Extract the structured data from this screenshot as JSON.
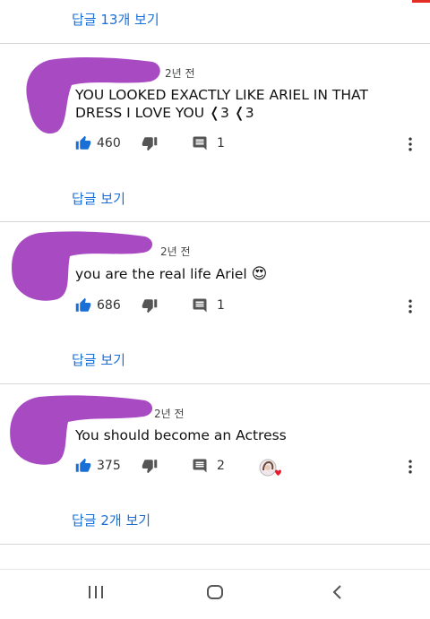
{
  "colors": {
    "link": "#1a6fd6",
    "scribble": "#a84bc3",
    "heart": "#e51c2c"
  },
  "top_replies_link": "답글 13개 보기",
  "comments": [
    {
      "time": "2년 전",
      "text": "YOU LOOKED EXACTLY LIKE ARIEL IN THAT DRESS I LOVE YOU ❬3 ❬3",
      "likes": "460",
      "replies_count": "1",
      "reply_link": "답글 보기"
    },
    {
      "time": "2년 전",
      "text": "you are the real life Ariel",
      "emoji": "😍",
      "likes": "686",
      "replies_count": "1",
      "reply_link": "답글 보기"
    },
    {
      "time": "2년 전",
      "text": "You should become an Actress",
      "likes": "375",
      "replies_count": "2",
      "reply_link": "답글 2개 보기",
      "creator_heart": true
    }
  ],
  "icons": [
    "thumb-up-icon",
    "thumb-down-icon",
    "comment-icon",
    "more-vert-icon",
    "creator-heart-icon",
    "recent-apps-icon",
    "home-icon",
    "back-icon"
  ]
}
